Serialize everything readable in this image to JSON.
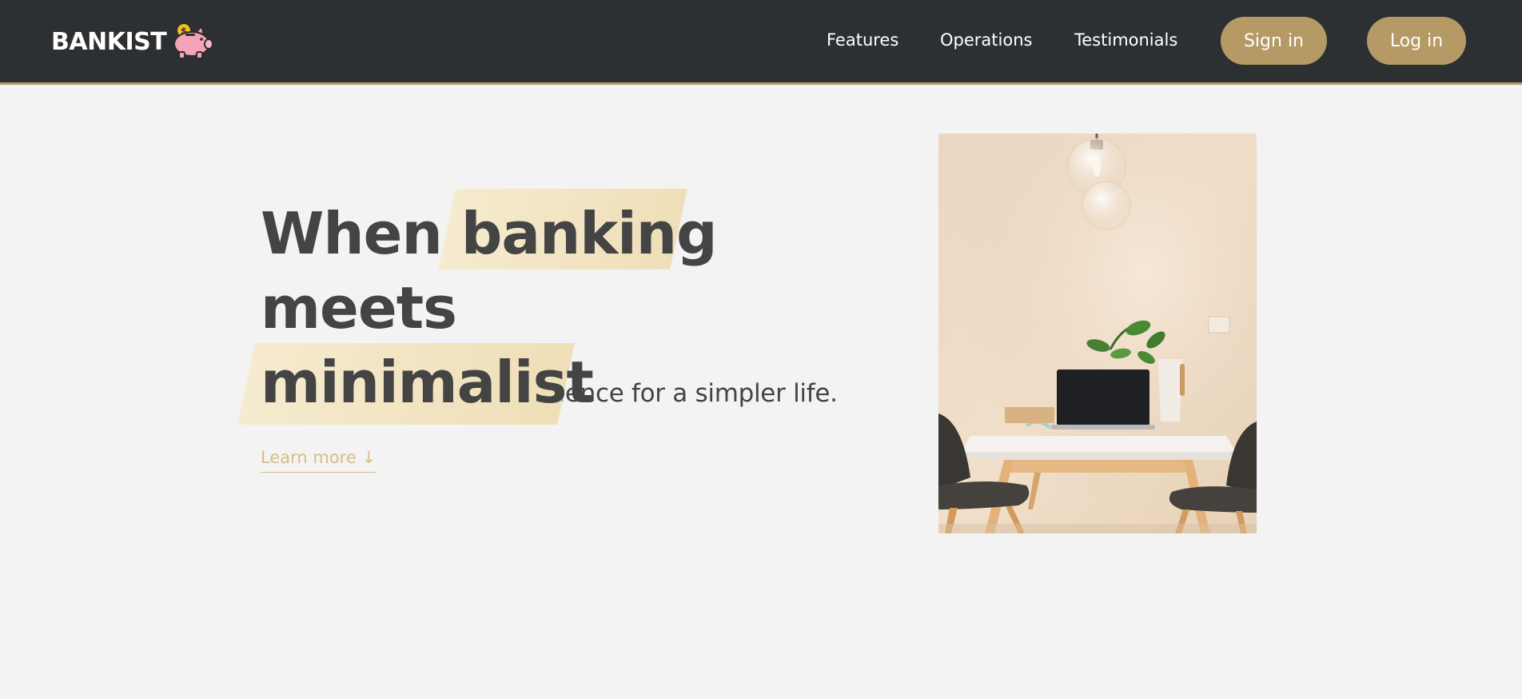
{
  "nav": {
    "brand": "BANKIST",
    "brand_icon": "piggy-bank-icon",
    "links": [
      {
        "label": "Features"
      },
      {
        "label": "Operations"
      },
      {
        "label": "Testimonials"
      }
    ],
    "sign_in_label": "Sign in",
    "log_in_label": "Log in"
  },
  "hero": {
    "title_line1_prefix": "When ",
    "title_highlight1": "banking",
    "title_line1_suffix": " meets",
    "title_highlight2": "minimalist",
    "subtitle": "A simpler banking experience for a simpler life.",
    "learn_more": "Learn more ↓",
    "image_icon": "desk-photo-illustration"
  },
  "colors": {
    "nav_bg": "#2d3033",
    "accent": "#b59a66",
    "highlight": "#f3e4c2",
    "text": "#444444",
    "link_muted": "#d6bd8a",
    "page_bg": "#f3f3f3"
  }
}
